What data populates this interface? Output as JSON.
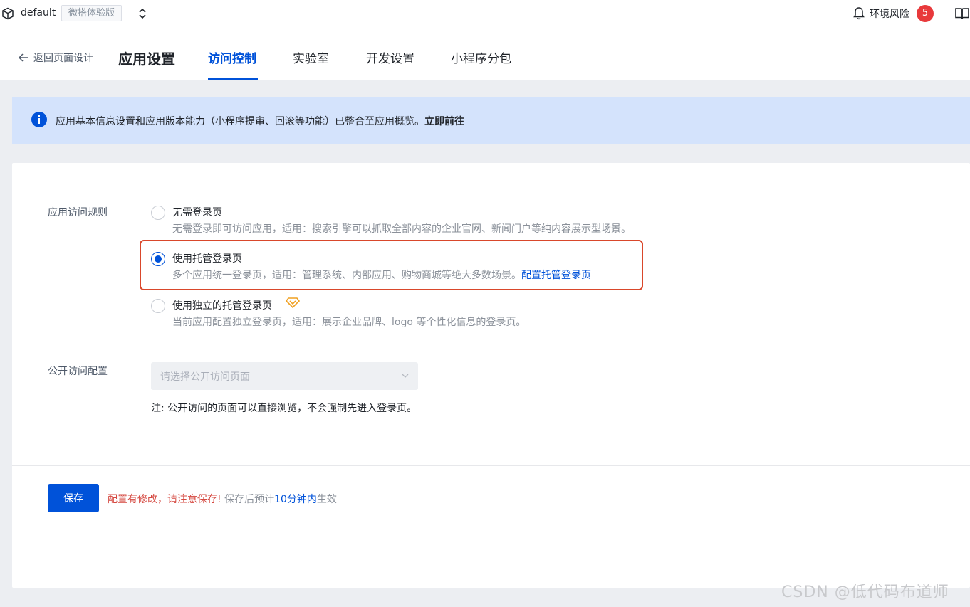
{
  "topbar": {
    "env_name": "default",
    "env_tag": "微搭体验版",
    "risk_label": "环境风险",
    "risk_count": "5"
  },
  "nav": {
    "back_label": "返回页面设计",
    "title": "应用设置",
    "tabs": [
      {
        "label": "访问控制",
        "active": true
      },
      {
        "label": "实验室",
        "active": false
      },
      {
        "label": "开发设置",
        "active": false
      },
      {
        "label": "小程序分包",
        "active": false
      }
    ]
  },
  "notice": {
    "text": "应用基本信息设置和应用版本能力（小程序提审、回滚等功能）已整合至应用概览。",
    "link": "立即前往"
  },
  "access_rule": {
    "label": "应用访问规则",
    "options": [
      {
        "title": "无需登录页",
        "desc": "无需登录即可访问应用，适用：搜索引擎可以抓取全部内容的企业官网、新闻门户等纯内容展示型场景。",
        "link": "",
        "checked": false
      },
      {
        "title": "使用托管登录页",
        "desc": "多个应用统一登录页，适用：管理系统、内部应用、购物商城等绝大多数场景。",
        "link": "配置托管登录页",
        "checked": true
      },
      {
        "title": "使用独立的托管登录页",
        "desc": "当前应用配置独立登录页，适用：展示企业品牌、logo 等个性化信息的登录页。",
        "link": "",
        "checked": false
      }
    ]
  },
  "public_access": {
    "label": "公开访问配置",
    "placeholder": "请选择公开访问页面",
    "note": "注: 公开访问的页面可以直接浏览，不会强制先进入登录页。"
  },
  "footer": {
    "save_label": "保存",
    "hint_warn": "配置有修改，请注意保存!",
    "hint_prefix": " 保存后预计",
    "hint_time": "10分钟内",
    "hint_suffix": "生效"
  },
  "watermark": "CSDN @低代码布道师",
  "colors": {
    "primary": "#0052d9",
    "notice_bg": "#d4e3fc",
    "warn": "#d54941",
    "badge": "#e8393b",
    "highlight_border": "#d9472b"
  }
}
